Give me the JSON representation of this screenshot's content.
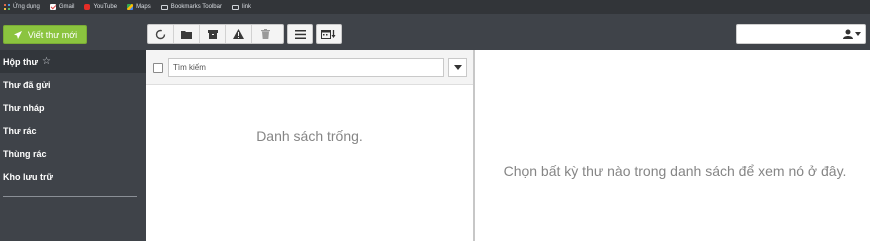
{
  "bookmarks": [
    {
      "label": "Ứng dụng",
      "icon": "apps-icon"
    },
    {
      "label": "Gmail",
      "icon": "gmail-icon"
    },
    {
      "label": "YouTube",
      "icon": "youtube-icon"
    },
    {
      "label": "Maps",
      "icon": "maps-icon"
    },
    {
      "label": "Bookmarks Toolbar",
      "icon": "folder-icon"
    },
    {
      "label": "link",
      "icon": "folder-icon"
    }
  ],
  "compose": {
    "label": "Viết thư mới",
    "icon": "paper-plane-icon",
    "color": "#8bc43f"
  },
  "sidebar": {
    "items": [
      {
        "label": "Hộp thư",
        "icon": "star-icon",
        "active": true
      },
      {
        "label": "Thư đã gửi"
      },
      {
        "label": "Thư nháp"
      },
      {
        "label": "Thư rác"
      },
      {
        "label": "Thùng rác"
      },
      {
        "label": "Kho lưu trữ"
      }
    ]
  },
  "toolbar": {
    "buttons": [
      "refresh-icon",
      "folder-move-icon",
      "archive-icon",
      "spam-warning-icon",
      "trash-icon",
      "menu-icon",
      "calendar-sort-icon"
    ]
  },
  "account": {
    "icon": "user-icon",
    "value": ""
  },
  "list": {
    "search_placeholder": "Tìm kiếm",
    "empty_message": "Danh sách trống."
  },
  "preview": {
    "message": "Chọn bất kỳ thư nào trong danh sách để xem nó ở đây."
  },
  "colors": {
    "background": "#3f4349",
    "accent_green": "#8bc43f",
    "text_muted": "#858585"
  }
}
